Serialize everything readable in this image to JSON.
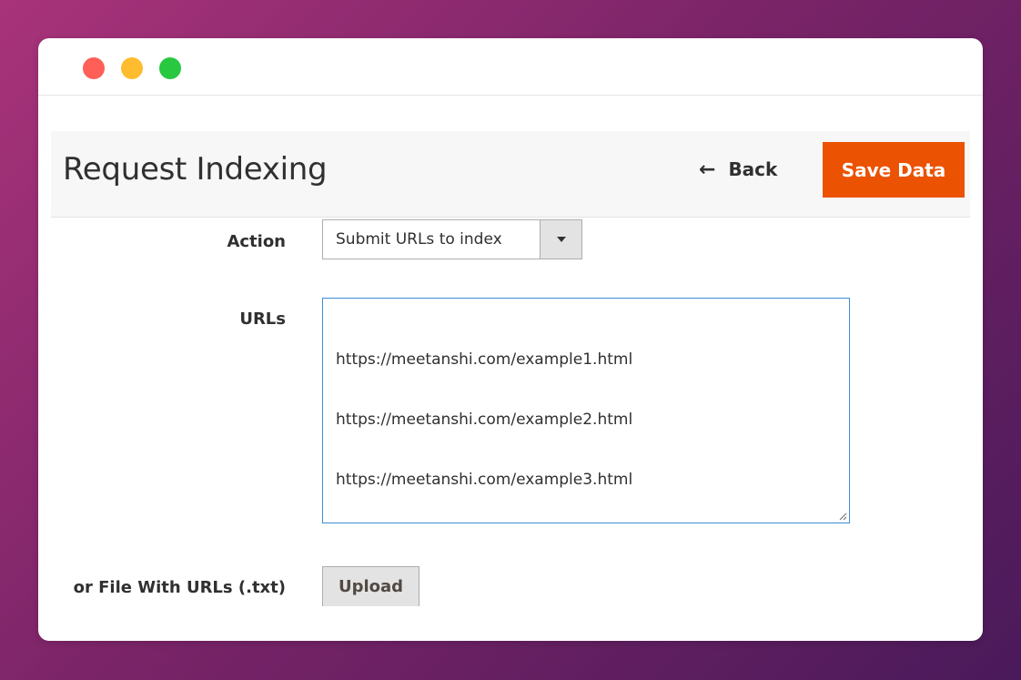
{
  "window": {
    "controls": [
      "close",
      "minimize",
      "maximize"
    ],
    "control_colors": {
      "close": "#fe5f57",
      "minimize": "#febc2e",
      "maximize": "#28c840"
    }
  },
  "header": {
    "title": "Request Indexing",
    "back_label": "Back",
    "back_icon": "arrow-left-icon",
    "save_label": "Save Data",
    "save_color": "#eb5202"
  },
  "form": {
    "action": {
      "label": "Action",
      "selected": "Submit URLs to index",
      "icon": "dropdown-arrow-icon"
    },
    "urls": {
      "label": "URLs",
      "value": [
        "https://meetanshi.com/example1.html",
        "https://meetanshi.com/example2.html",
        "https://meetanshi.com/example3.html"
      ]
    },
    "file": {
      "label": "or File With URLs (.txt)",
      "button_label": "Upload"
    }
  }
}
